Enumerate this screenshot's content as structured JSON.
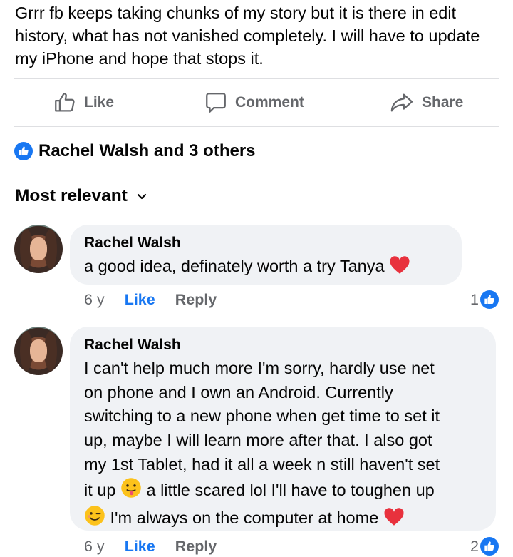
{
  "post": {
    "text": "Grrr fb keeps taking chunks of my story but it is there in edit history, what has not vanished completely.  I will have to update my iPhone and hope that stops it."
  },
  "actions": {
    "like": "Like",
    "comment": "Comment",
    "share": "Share"
  },
  "reactions": {
    "summary": "Rachel Walsh and 3 others",
    "icon": "like-icon"
  },
  "sort": {
    "label": "Most relevant",
    "icon": "chevron-down-icon"
  },
  "comments": [
    {
      "author": "Rachel Walsh",
      "text_lines": [
        "a good idea, definately worth a try Tanya"
      ],
      "age": "6 y",
      "like_label": "Like",
      "reply_label": "Reply",
      "like_count": "1"
    },
    {
      "author": "Rachel Walsh",
      "text_lines": [
        "I can't help much more I'm sorry, hardly use net",
        "on phone and I own an Android. Currently",
        "switching to a new phone when get time to set it",
        "up, maybe I will learn more after that. I also got",
        "my 1st Tablet, had it all a week n still haven't set",
        "it up",
        "a little scared lol I'll have to toughen up",
        "I'm always on the computer at home"
      ],
      "age": "6 y",
      "like_label": "Like",
      "reply_label": "Reply",
      "like_count": "2"
    }
  ],
  "colors": {
    "accent": "#1877f2",
    "secondary_text": "#65676b",
    "bubble": "#f0f2f5",
    "heart": "#e8313d"
  }
}
